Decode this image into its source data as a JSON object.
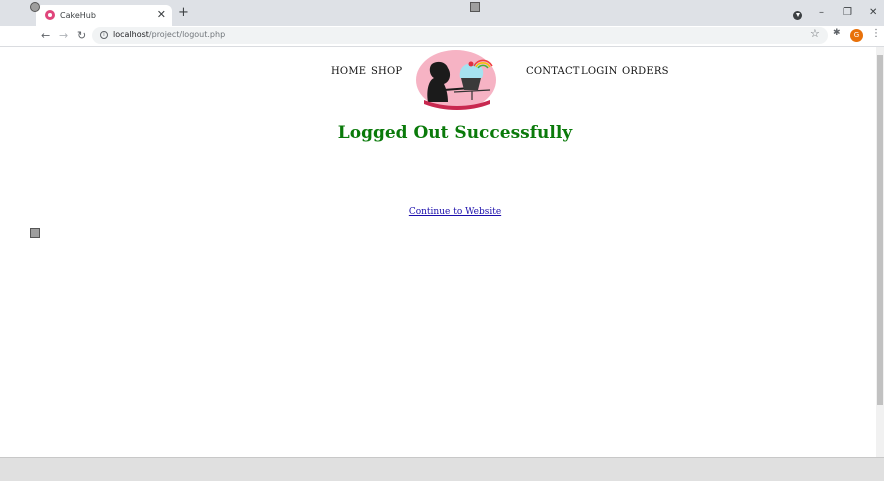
{
  "browser": {
    "tab_title": "CakeHub",
    "tab_close": "✕",
    "new_tab": "+",
    "url_host": "localhost",
    "url_path": "/project/logout.php",
    "profile_initial": "G",
    "back": "←",
    "forward": "→",
    "reload": "↻",
    "minimize": "–",
    "restore": "❐",
    "close": "✕",
    "star": "☆",
    "extensions": "✱",
    "menu": "⋮"
  },
  "nav": {
    "home": "HOME",
    "shop": "SHOP",
    "contact": "CONTACT",
    "login": "LOGIN",
    "orders": "ORDERS"
  },
  "main": {
    "heading": "Logged Out Successfully",
    "continue_link": "Continue to Website"
  },
  "colors": {
    "heading": "#0a7a0a",
    "link": "#1a0dab",
    "logo_bg": "#f6b3c4"
  }
}
